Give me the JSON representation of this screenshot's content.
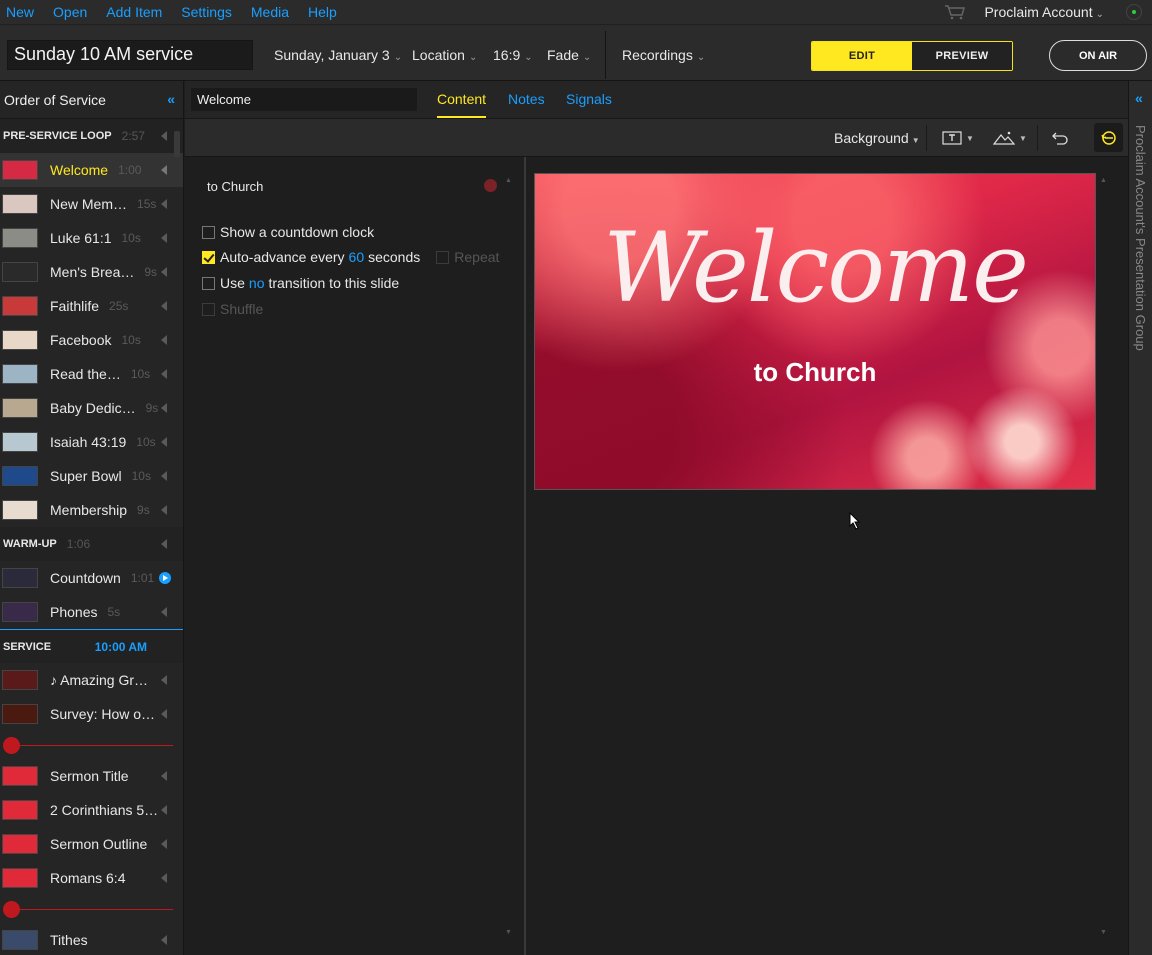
{
  "menu": {
    "items": [
      "New",
      "Open",
      "Add Item",
      "Settings",
      "Media",
      "Help"
    ],
    "account_label": "Proclaim Account"
  },
  "toolbar": {
    "service_title": "Sunday 10 AM service",
    "date": "Sunday, January 3",
    "location": "Location",
    "aspect": "16:9",
    "transition": "Fade",
    "recordings": "Recordings",
    "edit_label": "EDIT",
    "preview_label": "PREVIEW",
    "onair_label": "ON AIR"
  },
  "sidebar": {
    "title": "Order of Service",
    "sections": [
      {
        "name": "PRE-SERVICE LOOP",
        "duration": "2:57",
        "items": [
          {
            "label": "Welcome",
            "duration": "1:00",
            "active": true,
            "thumb": "#d62a44"
          },
          {
            "label": "New Mem…",
            "duration": "15s",
            "thumb": "#d9c7c0"
          },
          {
            "label": "Luke 61:1",
            "duration": "10s",
            "thumb": "#8c8c86"
          },
          {
            "label": "Men's Brea…",
            "duration": "9s",
            "thumb": "#2a2a2a"
          },
          {
            "label": "Faithlife",
            "duration": "25s",
            "thumb": "#c83a3a"
          },
          {
            "label": "Facebook",
            "duration": "10s",
            "thumb": "#e8d8c8"
          },
          {
            "label": "Read the…",
            "duration": "10s",
            "thumb": "#9cb4c4"
          },
          {
            "label": "Baby Dedic…",
            "duration": "9s",
            "thumb": "#b8a890"
          },
          {
            "label": "Isaiah 43:19",
            "duration": "10s",
            "thumb": "#b8c8d0"
          },
          {
            "label": "Super Bowl",
            "duration": "10s",
            "thumb": "#1e4a8c"
          },
          {
            "label": "Membership",
            "duration": "9s",
            "thumb": "#e8dcd0"
          }
        ]
      },
      {
        "name": "WARM-UP",
        "duration": "1:06",
        "items": [
          {
            "label": "Countdown",
            "duration": "1:01",
            "thumb": "#2a2a3a",
            "playing": true
          },
          {
            "label": "Phones",
            "duration": "5s",
            "thumb": "#3a2a4a"
          }
        ]
      },
      {
        "name": "SERVICE",
        "time": "10:00 AM",
        "items": [
          {
            "label": "♪ Amazing Gr…",
            "duration": "",
            "thumb": "#5a1a1a"
          },
          {
            "label": "Survey: How o…",
            "duration": "",
            "thumb": "#4a1a10"
          },
          {
            "label": "Sermon Title",
            "duration": "",
            "thumb": "#e02a3a"
          },
          {
            "label": "2 Corinthians 5…",
            "duration": "",
            "thumb": "#e02a3a"
          },
          {
            "label": "Sermon Outline",
            "duration": "",
            "thumb": "#e02a3a"
          },
          {
            "label": "Romans 6:4",
            "duration": "",
            "thumb": "#e02a3a"
          },
          {
            "label": "Tithes",
            "duration": "",
            "thumb": "#3a4a6a"
          }
        ]
      }
    ]
  },
  "editor": {
    "item_name": "Welcome",
    "tabs": [
      "Content",
      "Notes",
      "Signals"
    ],
    "background_label": "Background",
    "slide_text_label": "to Church",
    "options": {
      "countdown": "Show a countdown clock",
      "auto_advance_pre": "Auto-advance every",
      "auto_advance_value": "60",
      "auto_advance_post": "seconds",
      "repeat": "Repeat",
      "transition_pre": "Use",
      "transition_value": "no",
      "transition_post": "transition to this slide",
      "shuffle": "Shuffle"
    }
  },
  "preview": {
    "headline": "Welcome",
    "subline": "to Church"
  },
  "group_panel": {
    "title": "Proclaim Account's Presentation Group"
  }
}
